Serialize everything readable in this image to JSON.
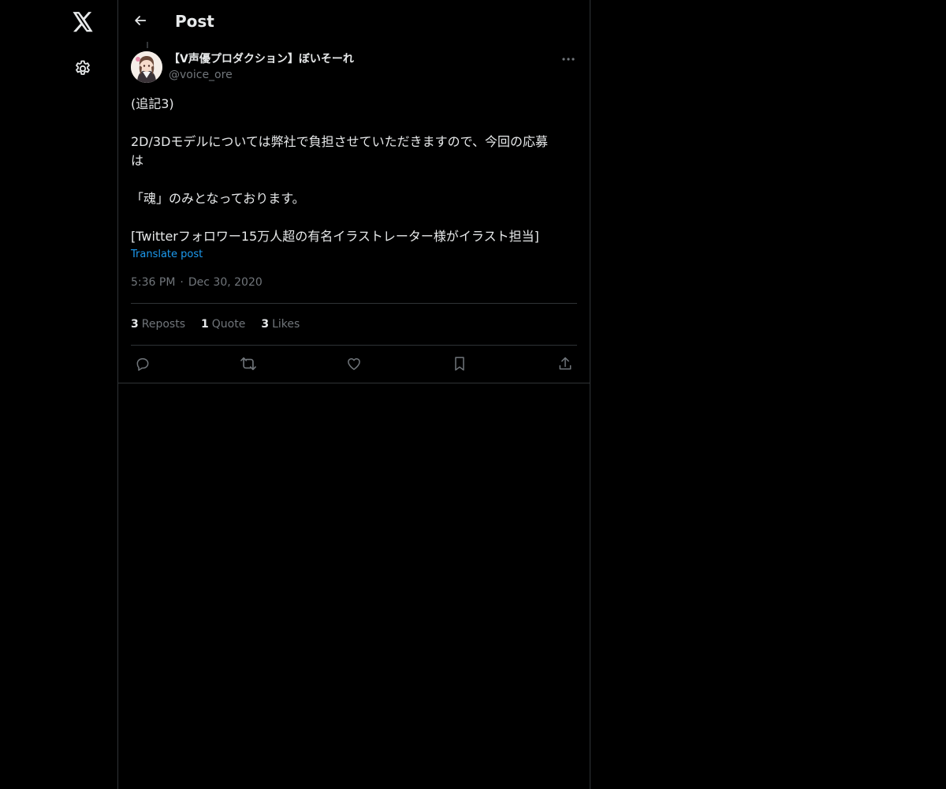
{
  "nav": {
    "logo_icon": "x-logo-icon",
    "settings_icon": "gear-icon"
  },
  "header": {
    "title": "Post",
    "back_icon": "arrow-left-icon"
  },
  "post": {
    "author_name": "【V声優プロダクション】ぼいそーれ",
    "author_handle": "@voice_ore",
    "text_lines": [
      "(追記3)",
      "",
      "2D/3Dモデルについては弊社で負担させていただきますので、今回の応募",
      "は",
      "",
      "「魂」のみとなっております。",
      "",
      "[Twitterフォロワー15万人超の有名イラストレーター様がイラスト担当]"
    ],
    "translate_label": "Translate post",
    "time": "5:36 PM",
    "separator": "·",
    "date": "Dec 30, 2020",
    "stats": {
      "reposts_count": "3",
      "reposts_label": "Reposts",
      "quotes_count": "1",
      "quotes_label": "Quote",
      "likes_count": "3",
      "likes_label": "Likes"
    }
  },
  "colors": {
    "background": "#000000",
    "border": "#2f3336",
    "text_primary": "#e7e9ea",
    "text_secondary": "#71767b",
    "link": "#1d9bf0"
  }
}
